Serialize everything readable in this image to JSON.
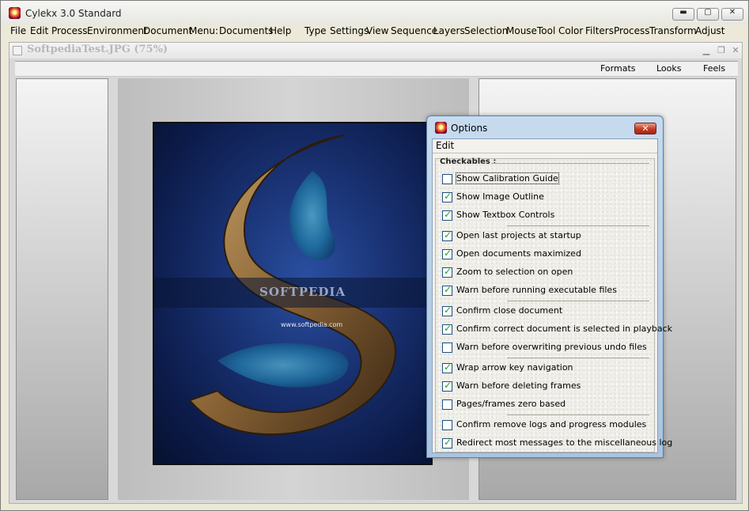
{
  "app": {
    "title": "Cylekx 3.0 Standard",
    "caption_buttons": {
      "minimize": "▬",
      "maximize": "▢",
      "close": "✕"
    }
  },
  "menubar": {
    "items": [
      "File",
      "Edit",
      "Process",
      "Environment",
      "Document",
      "Menu:",
      "Documents",
      "Help",
      "Type",
      "Settings",
      "View",
      "Sequence",
      "Layers",
      "Selection",
      "Mouse",
      "Tool",
      "Color",
      "Filters",
      "Process",
      "Transform",
      "Adjust"
    ]
  },
  "document": {
    "title": "SoftpediaTest.JPG (75%)",
    "buttons": {
      "minimize": "▁",
      "restore": "❐",
      "close": "✕"
    },
    "toolbar": {
      "formats": "Formats",
      "looks": "Looks",
      "feels": "Feels"
    }
  },
  "picture": {
    "watermark": "SOFTPEDIA",
    "url": "www.softpedia.com"
  },
  "dialog": {
    "title": "Options",
    "close_label": "✕",
    "menu": {
      "edit": "Edit"
    },
    "group_label": "Checkables :",
    "options": [
      {
        "label": "Show Calibration Guide",
        "checked": false
      },
      {
        "label": "Show Image Outline",
        "checked": true
      },
      {
        "label": "Show Textbox Controls",
        "checked": true
      },
      {
        "label": "Open last projects at startup",
        "checked": true
      },
      {
        "label": "Open documents maximized",
        "checked": true
      },
      {
        "label": "Zoom to selection on open",
        "checked": true
      },
      {
        "label": "Warn before running executable files",
        "checked": true
      },
      {
        "label": "Confirm close document",
        "checked": true
      },
      {
        "label": "Confirm correct document is selected in playback",
        "checked": true
      },
      {
        "label": "Warn before overwriting previous undo files",
        "checked": false
      },
      {
        "label": "Wrap arrow key navigation",
        "checked": true
      },
      {
        "label": "Warn before deleting frames",
        "checked": true
      },
      {
        "label": "Pages/frames zero based",
        "checked": false
      },
      {
        "label": "Confirm remove logs and progress modules",
        "checked": false
      },
      {
        "label": "Redirect most messages to the miscellaneous log",
        "checked": true
      }
    ]
  }
}
